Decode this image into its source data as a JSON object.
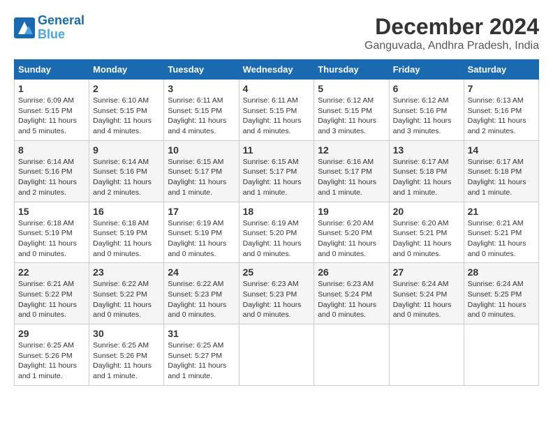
{
  "logo": {
    "line1": "General",
    "line2": "Blue"
  },
  "title": "December 2024",
  "location": "Ganguvada, Andhra Pradesh, India",
  "days_of_week": [
    "Sunday",
    "Monday",
    "Tuesday",
    "Wednesday",
    "Thursday",
    "Friday",
    "Saturday"
  ],
  "weeks": [
    [
      {
        "day": "1",
        "sunrise": "6:09 AM",
        "sunset": "5:15 PM",
        "daylight": "11 hours and 5 minutes."
      },
      {
        "day": "2",
        "sunrise": "6:10 AM",
        "sunset": "5:15 PM",
        "daylight": "11 hours and 4 minutes."
      },
      {
        "day": "3",
        "sunrise": "6:11 AM",
        "sunset": "5:15 PM",
        "daylight": "11 hours and 4 minutes."
      },
      {
        "day": "4",
        "sunrise": "6:11 AM",
        "sunset": "5:15 PM",
        "daylight": "11 hours and 4 minutes."
      },
      {
        "day": "5",
        "sunrise": "6:12 AM",
        "sunset": "5:15 PM",
        "daylight": "11 hours and 3 minutes."
      },
      {
        "day": "6",
        "sunrise": "6:12 AM",
        "sunset": "5:16 PM",
        "daylight": "11 hours and 3 minutes."
      },
      {
        "day": "7",
        "sunrise": "6:13 AM",
        "sunset": "5:16 PM",
        "daylight": "11 hours and 2 minutes."
      }
    ],
    [
      {
        "day": "8",
        "sunrise": "6:14 AM",
        "sunset": "5:16 PM",
        "daylight": "11 hours and 2 minutes."
      },
      {
        "day": "9",
        "sunrise": "6:14 AM",
        "sunset": "5:16 PM",
        "daylight": "11 hours and 2 minutes."
      },
      {
        "day": "10",
        "sunrise": "6:15 AM",
        "sunset": "5:17 PM",
        "daylight": "11 hours and 1 minute."
      },
      {
        "day": "11",
        "sunrise": "6:15 AM",
        "sunset": "5:17 PM",
        "daylight": "11 hours and 1 minute."
      },
      {
        "day": "12",
        "sunrise": "6:16 AM",
        "sunset": "5:17 PM",
        "daylight": "11 hours and 1 minute."
      },
      {
        "day": "13",
        "sunrise": "6:17 AM",
        "sunset": "5:18 PM",
        "daylight": "11 hours and 1 minute."
      },
      {
        "day": "14",
        "sunrise": "6:17 AM",
        "sunset": "5:18 PM",
        "daylight": "11 hours and 1 minute."
      }
    ],
    [
      {
        "day": "15",
        "sunrise": "6:18 AM",
        "sunset": "5:19 PM",
        "daylight": "11 hours and 0 minutes."
      },
      {
        "day": "16",
        "sunrise": "6:18 AM",
        "sunset": "5:19 PM",
        "daylight": "11 hours and 0 minutes."
      },
      {
        "day": "17",
        "sunrise": "6:19 AM",
        "sunset": "5:19 PM",
        "daylight": "11 hours and 0 minutes."
      },
      {
        "day": "18",
        "sunrise": "6:19 AM",
        "sunset": "5:20 PM",
        "daylight": "11 hours and 0 minutes."
      },
      {
        "day": "19",
        "sunrise": "6:20 AM",
        "sunset": "5:20 PM",
        "daylight": "11 hours and 0 minutes."
      },
      {
        "day": "20",
        "sunrise": "6:20 AM",
        "sunset": "5:21 PM",
        "daylight": "11 hours and 0 minutes."
      },
      {
        "day": "21",
        "sunrise": "6:21 AM",
        "sunset": "5:21 PM",
        "daylight": "11 hours and 0 minutes."
      }
    ],
    [
      {
        "day": "22",
        "sunrise": "6:21 AM",
        "sunset": "5:22 PM",
        "daylight": "11 hours and 0 minutes."
      },
      {
        "day": "23",
        "sunrise": "6:22 AM",
        "sunset": "5:22 PM",
        "daylight": "11 hours and 0 minutes."
      },
      {
        "day": "24",
        "sunrise": "6:22 AM",
        "sunset": "5:23 PM",
        "daylight": "11 hours and 0 minutes."
      },
      {
        "day": "25",
        "sunrise": "6:23 AM",
        "sunset": "5:23 PM",
        "daylight": "11 hours and 0 minutes."
      },
      {
        "day": "26",
        "sunrise": "6:23 AM",
        "sunset": "5:24 PM",
        "daylight": "11 hours and 0 minutes."
      },
      {
        "day": "27",
        "sunrise": "6:24 AM",
        "sunset": "5:24 PM",
        "daylight": "11 hours and 0 minutes."
      },
      {
        "day": "28",
        "sunrise": "6:24 AM",
        "sunset": "5:25 PM",
        "daylight": "11 hours and 0 minutes."
      }
    ],
    [
      {
        "day": "29",
        "sunrise": "6:25 AM",
        "sunset": "5:26 PM",
        "daylight": "11 hours and 1 minute."
      },
      {
        "day": "30",
        "sunrise": "6:25 AM",
        "sunset": "5:26 PM",
        "daylight": "11 hours and 1 minute."
      },
      {
        "day": "31",
        "sunrise": "6:25 AM",
        "sunset": "5:27 PM",
        "daylight": "11 hours and 1 minute."
      },
      null,
      null,
      null,
      null
    ]
  ]
}
